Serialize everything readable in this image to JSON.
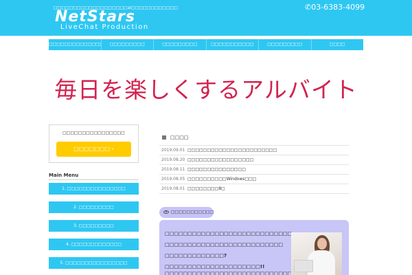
{
  "header": {
    "tagline": "□□□□□□□□□□□□□□□□□□□ai□□□□□□□□□□□□",
    "logo": "NetStars",
    "logo_sub": "LiveChat Production",
    "phone": "✆03-6383-4099"
  },
  "nav": {
    "items": [
      {
        "label": "□□□□□□□□□□□□□□□"
      },
      {
        "label": "□□□□□□□□□"
      },
      {
        "label": "□□□□□□□□□"
      },
      {
        "label": "□□□□□□□□□□□"
      },
      {
        "label": "□□□□□□□□□"
      },
      {
        "label": "□□□□"
      }
    ]
  },
  "hero": {
    "title": "毎日を楽しくするアルバイト"
  },
  "sidebar": {
    "box_text": "□□□□□□□□□□□□□□□□",
    "button_label": "□□□□□□□ ›",
    "menu_title": "Main Menu",
    "menu_items": [
      {
        "label": "1. □□□□□□□□□□□□□□□"
      },
      {
        "label": "2. □□□□□□□□□"
      },
      {
        "label": "3. □□□□□□□□□"
      },
      {
        "label": "4. □□□□□□□□□□□□□"
      },
      {
        "label": "5. □□□□□□□□□□□□□□□□"
      }
    ]
  },
  "news": {
    "heading": "□□□□",
    "items": [
      {
        "date": "2019.09.01",
        "title": "□□□□□□□□□□□□□□□□□□□□□□□"
      },
      {
        "date": "2019.08.20",
        "title": "□□□□□□□□□□□□□□□□□"
      },
      {
        "date": "2019.08.11",
        "title": "□□□□□□□□□□□□□□□"
      },
      {
        "date": "2019.08.05",
        "title": "□□□□□□□□□□Windows□□□"
      },
      {
        "date": "2019.08.01",
        "title": "□□□□□□□□8□"
      }
    ]
  },
  "feature": {
    "tag": "□□□□□□□□□□□",
    "lines": [
      "□□□□□□□□□□□□□□□□□□□□□□□□□□□□",
      "□□□□□□□□□□□□□□□□□□□□□□□□□□",
      "□□□□□□□□□□□□□?",
      "□□□□□□□□□□□□□□□□□□□□□!!",
      "□□□□□□□□□□□□□□□□□□□□□□□□□□□□"
    ]
  }
}
